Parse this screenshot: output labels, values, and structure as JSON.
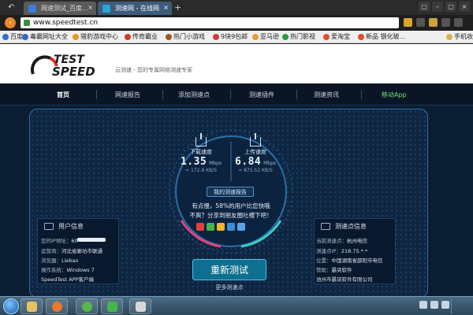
{
  "browser": {
    "tabs": [
      {
        "label": "网速测试_百度...",
        "close": "×"
      },
      {
        "label": "测速网 - 在线网",
        "close": "×"
      }
    ],
    "new_tab": "+",
    "address": "www.speedtest.cn",
    "bookmarks": [
      "百度",
      "毒霸网址大全",
      "猎豹游戏中心",
      "传奇霸业",
      "热门小游戏",
      "9块9包邮",
      "亚马逊",
      "热门影视",
      "爱淘宝",
      "新品 钢化玻...",
      "手机收"
    ]
  },
  "site": {
    "logo_text_1": "TEST",
    "logo_text_2": "SPEED",
    "slogan": "云测速 - 您的专属网络测速专家",
    "nav": [
      "首页",
      "网速报告",
      "添加测速点",
      "测速插件",
      "测速资讯",
      "移动App"
    ],
    "download": {
      "label": "下载速度",
      "value": "1.35",
      "unit": "Mbps",
      "sub": "≈ 172.8 KB/S"
    },
    "upload": {
      "label": "上传速度",
      "value": "6.84",
      "unit": "Mbps",
      "sub": "≈ 875.52 KB/S"
    },
    "report_button": "我的测速报告",
    "stat_line_1": "有点慢，58%的用户比您快哦",
    "stat_line_2": "不爽？分享到朋友圈吐槽下吧！",
    "retest_button": "重新测试",
    "more_points": "更多测速点",
    "user_info": {
      "title": "用户信息",
      "rows": [
        {
          "label": "您的IP地址：",
          "value": "60"
        },
        {
          "label": "运营商：",
          "value": "河北省廊坊市联通"
        },
        {
          "label": "浏览器：",
          "value": "Liebao"
        },
        {
          "label": "操作系统：",
          "value": "Windows 7"
        }
      ],
      "footer": "SpeedTest APP客户端"
    },
    "point_info": {
      "title": "测速点信息",
      "rows": [
        {
          "label": "当前测速点：",
          "value": "杭州电信"
        },
        {
          "label": "测速点IP：",
          "value": "218.75.*.*"
        },
        {
          "label": "位置：",
          "value": "中国湖南省邵阳市电信"
        },
        {
          "label": "赞助：",
          "value": "暴突软件"
        }
      ],
      "footer": "池州市暴突软件有限公司"
    }
  },
  "colors": {
    "panel_border": "#2d6ea8",
    "retest_bg": "#0f6f91",
    "app_link": "#6ee06e",
    "gauge_pink": "#e8417a",
    "gauge_teal": "#39d0c4"
  }
}
